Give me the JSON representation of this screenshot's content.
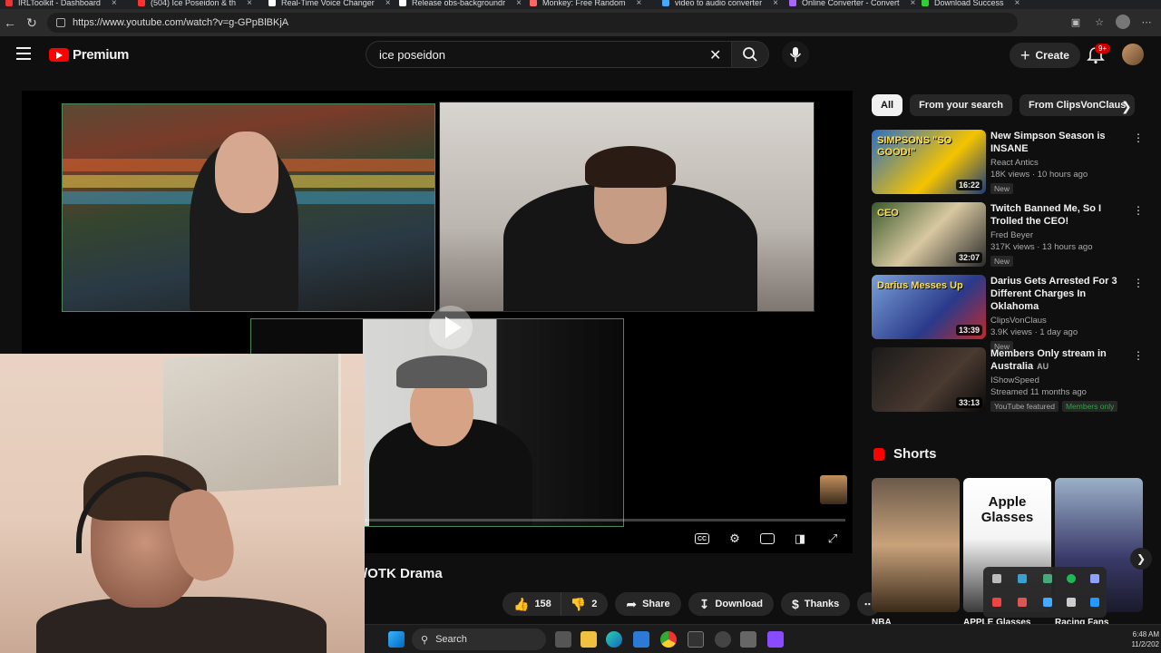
{
  "browser": {
    "tabs": [
      {
        "label": "IRLToolkit - Dashboard",
        "color": "#e33"
      },
      {
        "label": "(504) Ice Poseidon & th",
        "color": "#f33"
      },
      {
        "label": "Real-Time Voice Changer",
        "color": "#fff"
      },
      {
        "label": "Release obs-backgroundr",
        "color": "#fff"
      },
      {
        "label": "Monkey: Free Random",
        "color": "#f66"
      },
      {
        "label": "video to audio converter",
        "color": "#4af"
      },
      {
        "label": "Online Converter - Convert",
        "color": "#a6f"
      },
      {
        "label": "Download Success",
        "color": "#3c3"
      }
    ],
    "url": "https://www.youtube.com/watch?v=g-GPpBlBKjA"
  },
  "masthead": {
    "logo_text": "Premium",
    "search_value": "ice poseidon",
    "create_label": "Create",
    "notif_count": "9+"
  },
  "player": {
    "progress_fraction": 0.01
  },
  "video": {
    "title_partial": "/OTK Drama",
    "like_count": "158",
    "dislike_count": "2",
    "share_label": "Share",
    "download_label": "Download",
    "thanks_label": "Thanks"
  },
  "sidebar": {
    "chips": [
      "All",
      "From your search",
      "From ClipsVonClaus"
    ],
    "recommendations": [
      {
        "title": "New Simpson Season is INSANE",
        "channel": "React Antics",
        "meta": "18K views · 10 hours ago",
        "badge": "New",
        "duration": "16:22",
        "thumb_text": "SIMPSONS \"SO GOOD!\""
      },
      {
        "title": "Twitch Banned Me, So I Trolled the CEO!",
        "channel": "Fred Beyer",
        "meta": "317K views · 13 hours ago",
        "badge": "New",
        "duration": "32:07",
        "thumb_text": "CEO"
      },
      {
        "title": "Darius Gets Arrested For 3 Different Charges In Oklahoma",
        "channel": "ClipsVonClaus",
        "meta": "3.9K views · 1 day ago",
        "badge": "New",
        "duration": "13:39",
        "thumb_text": "Darius Messes Up"
      },
      {
        "title": "Members Only stream in Australia",
        "title_suffix": "AU",
        "channel": "IShowSpeed",
        "meta": "Streamed 11 months ago",
        "badge": "YouTube featured",
        "badge2": "Members only",
        "duration": "33:13",
        "thumb_text": ""
      }
    ],
    "shorts_heading": "Shorts",
    "shorts": [
      {
        "label": "NBA",
        "thumb_text": ""
      },
      {
        "label": "APPLE Glasses",
        "thumb_text": "Apple Glasses"
      },
      {
        "label": "Racing Fans",
        "thumb_text": ""
      }
    ]
  },
  "taskbar": {
    "search_label": "Search",
    "time": "6:48 AM",
    "date": "11/2/202"
  }
}
